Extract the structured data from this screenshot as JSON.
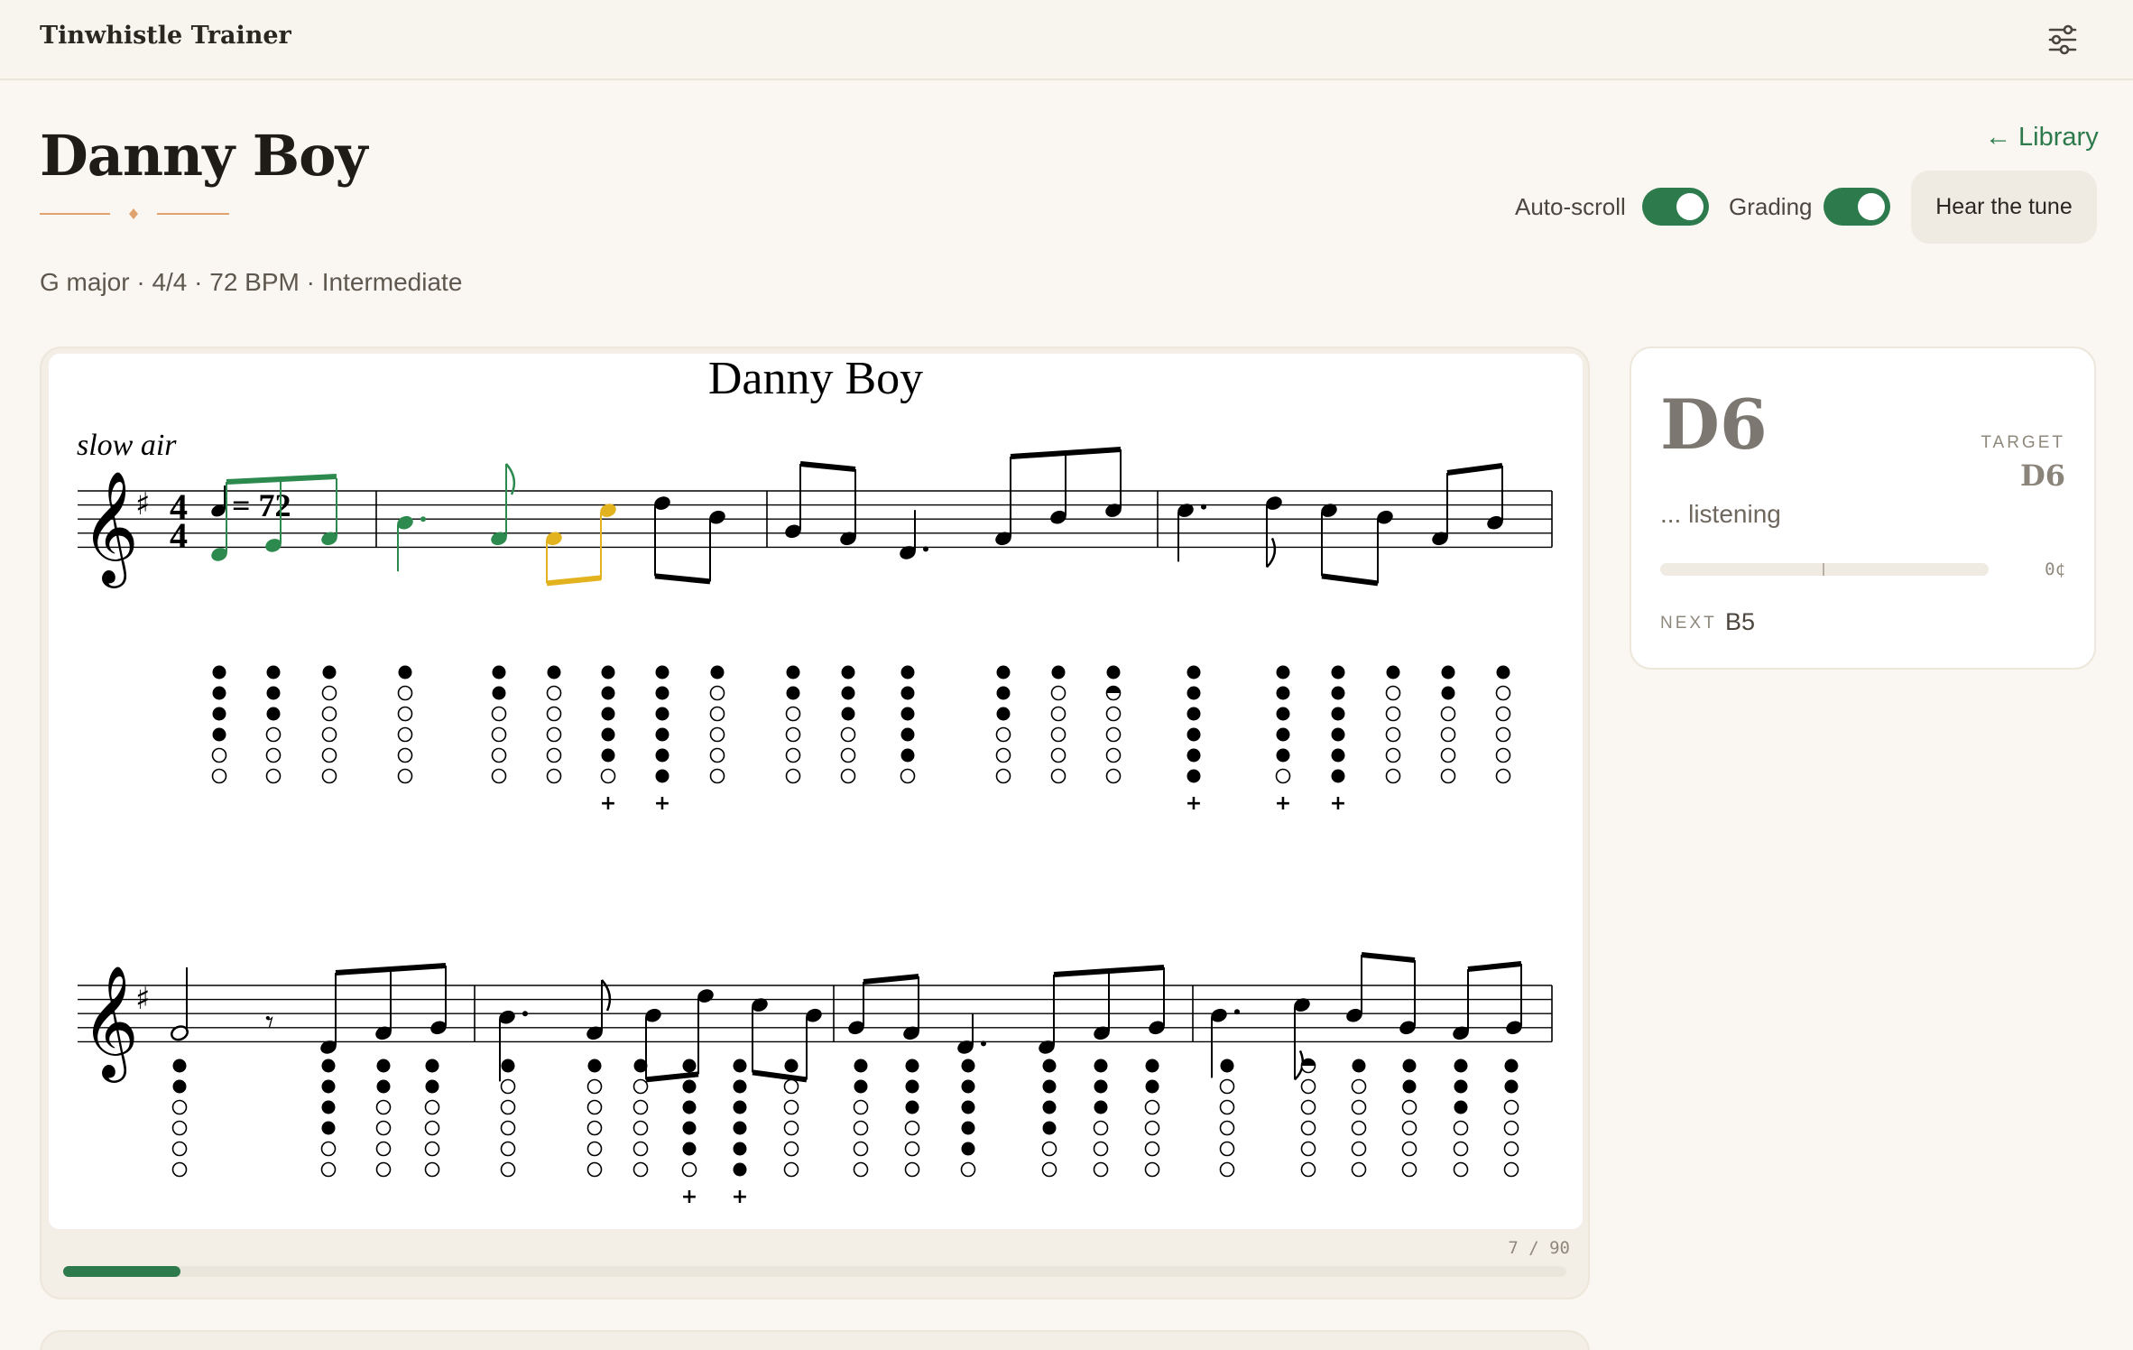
{
  "app": {
    "title": "Tinwhistle Trainer"
  },
  "header": {
    "settings_icon": "sliders-icon"
  },
  "song": {
    "title": "Danny Boy",
    "meta": "G major · 4/4 · 72 BPM · Intermediate"
  },
  "nav": {
    "library_label": "← Library"
  },
  "controls": {
    "autoscroll_label": "Auto-scroll",
    "autoscroll_on": true,
    "grading_label": "Grading",
    "grading_on": true,
    "hear_label": "Hear the tune"
  },
  "sheet": {
    "title": "Danny Boy",
    "tempo_text": "slow air",
    "tempo_mark": "= 72",
    "key_signature": "G major (1 sharp)",
    "time_signature": "4/4",
    "colors": {
      "played": "#2d8a4e",
      "current": "#e3b21f",
      "ink": "#000000"
    }
  },
  "progress": {
    "current": 7,
    "total": 90,
    "text": "7 / 90"
  },
  "target_panel": {
    "detected": "D6",
    "target_label": "TARGET",
    "target_note": "D6",
    "status": "... listening",
    "cents": "0¢",
    "next_label": "NEXT",
    "next_note": "B5"
  },
  "colors": {
    "accent": "#2d7b4d",
    "background": "#faf7f2",
    "ornament": "#e0a36f"
  }
}
